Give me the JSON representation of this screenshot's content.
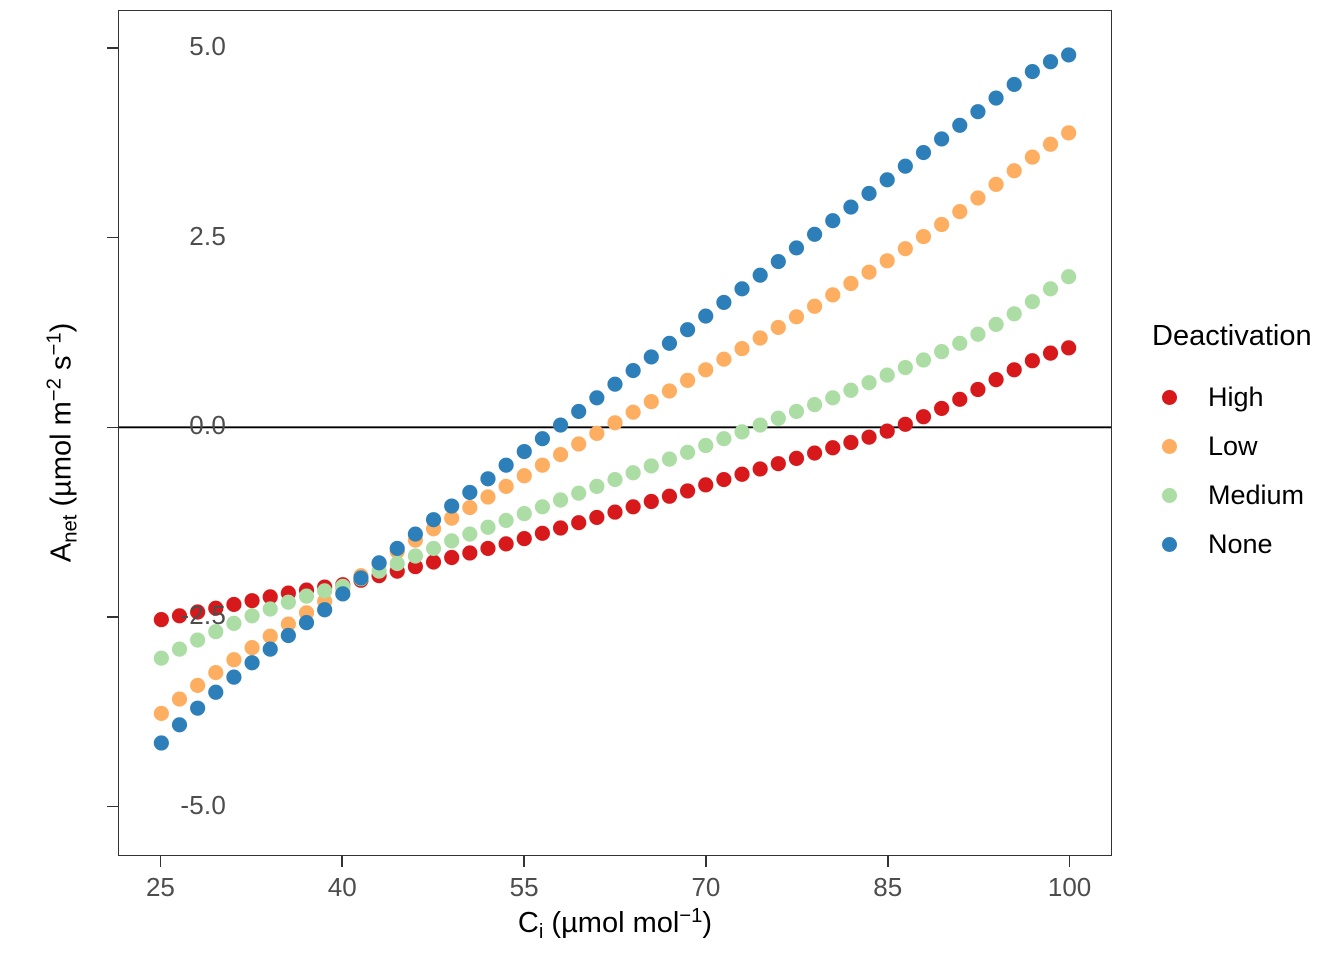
{
  "chart_data": {
    "type": "scatter",
    "title": "",
    "xlabel": "C_i (umol mol^-1)",
    "ylabel": "A_net (umol m^-2 s^-1)",
    "xlim": [
      21.5,
      103.5
    ],
    "ylim": [
      -5.65,
      5.5
    ],
    "xticks": [
      25,
      40,
      55,
      70,
      85,
      100
    ],
    "xtick_labels": [
      "25",
      "40",
      "55",
      "70",
      "85",
      "100"
    ],
    "yticks": [
      5.0,
      2.5,
      0.0,
      -2.5,
      -5.0
    ],
    "ytick_labels": [
      "5.0",
      "2.5",
      "0.0",
      "-2.5",
      "-5.0"
    ],
    "grid": false,
    "hline_at": 0.0,
    "legend_position": "right",
    "legend_title": "Deactivation",
    "x": [
      25.0,
      26.5,
      28.0,
      29.5,
      31.0,
      32.5,
      34.0,
      35.5,
      37.0,
      38.5,
      40.0,
      41.5,
      43.0,
      44.5,
      46.0,
      47.5,
      49.0,
      50.5,
      52.0,
      53.5,
      55.0,
      56.5,
      58.0,
      59.5,
      61.0,
      62.5,
      64.0,
      65.5,
      67.0,
      68.5,
      70.0,
      71.5,
      73.0,
      74.5,
      76.0,
      77.5,
      79.0,
      80.5,
      82.0,
      83.5,
      85.0,
      86.5,
      88.0,
      89.5,
      91.0,
      92.5,
      94.0,
      95.5,
      97.0,
      98.5,
      100.0
    ],
    "series": [
      {
        "name": "High",
        "color": "#D7191C",
        "values": [
          -2.54,
          -2.49,
          -2.44,
          -2.39,
          -2.34,
          -2.29,
          -2.24,
          -2.19,
          -2.15,
          -2.11,
          -2.08,
          -2.02,
          -1.96,
          -1.9,
          -1.84,
          -1.78,
          -1.72,
          -1.66,
          -1.6,
          -1.54,
          -1.47,
          -1.4,
          -1.33,
          -1.26,
          -1.19,
          -1.12,
          -1.05,
          -0.98,
          -0.91,
          -0.84,
          -0.76,
          -0.69,
          -0.62,
          -0.55,
          -0.48,
          -0.41,
          -0.34,
          -0.27,
          -0.2,
          -0.13,
          -0.05,
          0.04,
          0.14,
          0.25,
          0.37,
          0.5,
          0.63,
          0.76,
          0.88,
          0.98,
          1.05
        ]
      },
      {
        "name": "Low",
        "color": "#FDAE61",
        "values": [
          -3.78,
          -3.59,
          -3.41,
          -3.24,
          -3.07,
          -2.91,
          -2.76,
          -2.6,
          -2.45,
          -2.3,
          -2.13,
          -1.96,
          -1.8,
          -1.64,
          -1.49,
          -1.34,
          -1.2,
          -1.06,
          -0.92,
          -0.78,
          -0.64,
          -0.5,
          -0.36,
          -0.22,
          -0.08,
          0.06,
          0.2,
          0.34,
          0.48,
          0.62,
          0.76,
          0.9,
          1.04,
          1.18,
          1.32,
          1.46,
          1.6,
          1.75,
          1.9,
          2.05,
          2.2,
          2.36,
          2.52,
          2.68,
          2.85,
          3.03,
          3.21,
          3.39,
          3.57,
          3.74,
          3.89
        ]
      },
      {
        "name": "Medium",
        "color": "#ABDDA4",
        "values": [
          -3.05,
          -2.93,
          -2.81,
          -2.7,
          -2.59,
          -2.49,
          -2.4,
          -2.31,
          -2.23,
          -2.16,
          -2.1,
          -2.0,
          -1.9,
          -1.8,
          -1.7,
          -1.6,
          -1.5,
          -1.41,
          -1.32,
          -1.23,
          -1.14,
          -1.05,
          -0.96,
          -0.87,
          -0.78,
          -0.69,
          -0.6,
          -0.51,
          -0.42,
          -0.33,
          -0.24,
          -0.15,
          -0.06,
          0.03,
          0.12,
          0.21,
          0.3,
          0.39,
          0.49,
          0.59,
          0.69,
          0.79,
          0.89,
          1.0,
          1.11,
          1.23,
          1.36,
          1.5,
          1.66,
          1.83,
          1.99
        ]
      },
      {
        "name": "None",
        "color": "#2C7FB8",
        "values": [
          -4.17,
          -3.93,
          -3.71,
          -3.5,
          -3.3,
          -3.11,
          -2.93,
          -2.75,
          -2.58,
          -2.41,
          -2.2,
          -1.99,
          -1.79,
          -1.6,
          -1.41,
          -1.22,
          -1.04,
          -0.86,
          -0.68,
          -0.5,
          -0.32,
          -0.15,
          0.03,
          0.21,
          0.39,
          0.57,
          0.75,
          0.93,
          1.11,
          1.29,
          1.47,
          1.65,
          1.83,
          2.01,
          2.19,
          2.37,
          2.55,
          2.73,
          2.91,
          3.09,
          3.27,
          3.45,
          3.63,
          3.81,
          3.99,
          4.17,
          4.35,
          4.53,
          4.7,
          4.83,
          4.92
        ]
      }
    ]
  },
  "axes": {
    "x_title_main": "C",
    "x_title_sub": "i",
    "x_title_units_pre": " (µmol mol",
    "x_title_units_sup": "−1",
    "x_title_units_post": ")",
    "y_title_main": "A",
    "y_title_sub": "net",
    "y_title_units_pre": " (µmol m",
    "y_title_units_sup1": "−2",
    "y_title_units_mid": " s",
    "y_title_units_sup2": "−1",
    "y_title_units_post": ")"
  },
  "legend": {
    "title": "Deactivation",
    "items": [
      {
        "label": "High",
        "color": "#D7191C"
      },
      {
        "label": "Low",
        "color": "#FDAE61"
      },
      {
        "label": "Medium",
        "color": "#ABDDA4"
      },
      {
        "label": "None",
        "color": "#2C7FB8"
      }
    ]
  },
  "style": {
    "panel_border": "#333333",
    "tick_label_color": "#4d4d4d",
    "hline_color": "#000000"
  }
}
